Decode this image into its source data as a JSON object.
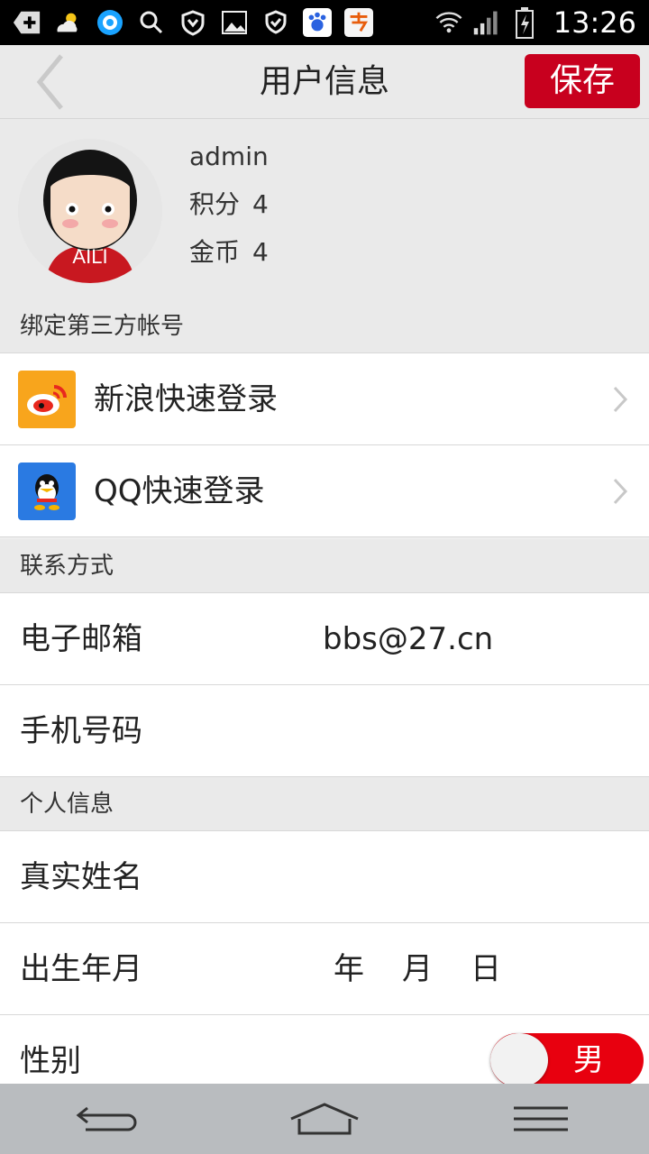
{
  "status_bar": {
    "time": "13:26"
  },
  "header": {
    "title": "用户信息",
    "save_label": "保存"
  },
  "profile": {
    "avatar_text": "AILI",
    "username": "admin",
    "points_label": "积分",
    "points_value": "4",
    "coins_label": "金币",
    "coins_value": "4"
  },
  "sections": {
    "bind": "绑定第三方帐号",
    "contact": "联系方式",
    "personal": "个人信息"
  },
  "social": {
    "weibo_label": "新浪快速登录",
    "qq_label": "QQ快速登录"
  },
  "contact": {
    "email_label": "电子邮箱",
    "email_value": "bbs@27.cn",
    "phone_label": "手机号码",
    "phone_value": ""
  },
  "personal": {
    "realname_label": "真实姓名",
    "birth_label": "出生年月",
    "year": "年",
    "month": "月",
    "day": "日",
    "gender_label": "性别",
    "gender_value": "男"
  },
  "colors": {
    "accent": "#c8001e",
    "toggle": "#e8000f"
  }
}
